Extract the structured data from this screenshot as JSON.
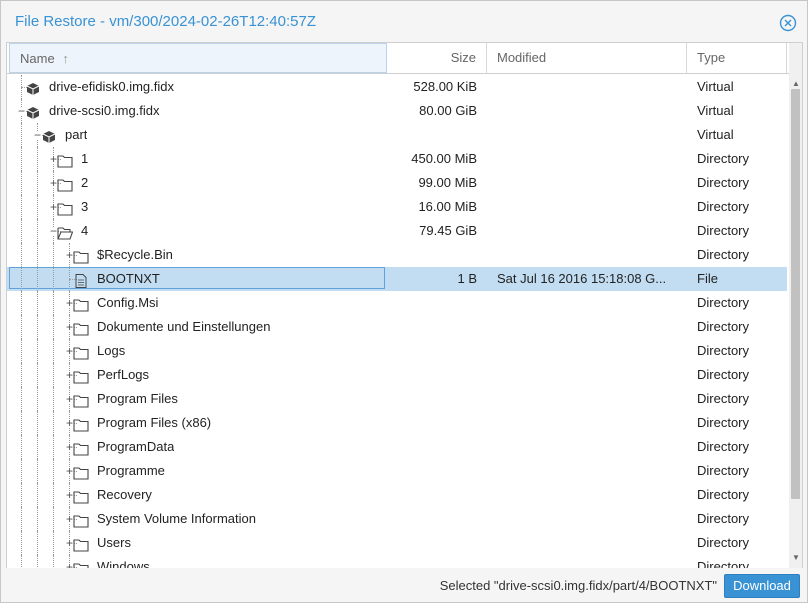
{
  "window": {
    "title": "File Restore - vm/300/2024-02-26T12:40:57Z",
    "accent_color": "#3892d4",
    "close_icon": "close-circle-icon"
  },
  "columns": {
    "name": "Name",
    "size": "Size",
    "modified": "Modified",
    "type": "Type",
    "sort_icon": "sort-ascending-arrow-icon"
  },
  "rows": [
    {
      "name": "drive-efidisk0.img.fidx",
      "size": "528.00 KiB",
      "modified": "",
      "type": "Virtual",
      "icon": "cube-icon",
      "depth": 0,
      "expander": "none",
      "selected": false
    },
    {
      "name": "drive-scsi0.img.fidx",
      "size": "80.00 GiB",
      "modified": "",
      "type": "Virtual",
      "icon": "cube-icon",
      "depth": 0,
      "expander": "minus",
      "selected": false
    },
    {
      "name": "part",
      "size": "",
      "modified": "",
      "type": "Virtual",
      "icon": "cube-icon",
      "depth": 1,
      "expander": "minus",
      "selected": false
    },
    {
      "name": "1",
      "size": "450.00 MiB",
      "modified": "",
      "type": "Directory",
      "icon": "folder-icon",
      "depth": 2,
      "expander": "plus",
      "selected": false
    },
    {
      "name": "2",
      "size": "99.00 MiB",
      "modified": "",
      "type": "Directory",
      "icon": "folder-icon",
      "depth": 2,
      "expander": "plus",
      "selected": false
    },
    {
      "name": "3",
      "size": "16.00 MiB",
      "modified": "",
      "type": "Directory",
      "icon": "folder-icon",
      "depth": 2,
      "expander": "plus",
      "selected": false
    },
    {
      "name": "4",
      "size": "79.45 GiB",
      "modified": "",
      "type": "Directory",
      "icon": "folder-open-icon",
      "depth": 2,
      "expander": "minus",
      "selected": false
    },
    {
      "name": "$Recycle.Bin",
      "size": "",
      "modified": "",
      "type": "Directory",
      "icon": "folder-icon",
      "depth": 3,
      "expander": "plus",
      "selected": false
    },
    {
      "name": "BOOTNXT",
      "size": "1 B",
      "modified": "Sat Jul 16 2016 15:18:08 G...",
      "type": "File",
      "icon": "file-icon",
      "depth": 3,
      "expander": "none",
      "selected": true
    },
    {
      "name": "Config.Msi",
      "size": "",
      "modified": "",
      "type": "Directory",
      "icon": "folder-icon",
      "depth": 3,
      "expander": "plus",
      "selected": false
    },
    {
      "name": "Dokumente und Einstellungen",
      "size": "",
      "modified": "",
      "type": "Directory",
      "icon": "folder-icon",
      "depth": 3,
      "expander": "plus",
      "selected": false
    },
    {
      "name": "Logs",
      "size": "",
      "modified": "",
      "type": "Directory",
      "icon": "folder-icon",
      "depth": 3,
      "expander": "plus",
      "selected": false
    },
    {
      "name": "PerfLogs",
      "size": "",
      "modified": "",
      "type": "Directory",
      "icon": "folder-icon",
      "depth": 3,
      "expander": "plus",
      "selected": false
    },
    {
      "name": "Program Files",
      "size": "",
      "modified": "",
      "type": "Directory",
      "icon": "folder-icon",
      "depth": 3,
      "expander": "plus",
      "selected": false
    },
    {
      "name": "Program Files (x86)",
      "size": "",
      "modified": "",
      "type": "Directory",
      "icon": "folder-icon",
      "depth": 3,
      "expander": "plus",
      "selected": false
    },
    {
      "name": "ProgramData",
      "size": "",
      "modified": "",
      "type": "Directory",
      "icon": "folder-icon",
      "depth": 3,
      "expander": "plus",
      "selected": false
    },
    {
      "name": "Programme",
      "size": "",
      "modified": "",
      "type": "Directory",
      "icon": "folder-icon",
      "depth": 3,
      "expander": "plus",
      "selected": false
    },
    {
      "name": "Recovery",
      "size": "",
      "modified": "",
      "type": "Directory",
      "icon": "folder-icon",
      "depth": 3,
      "expander": "plus",
      "selected": false
    },
    {
      "name": "System Volume Information",
      "size": "",
      "modified": "",
      "type": "Directory",
      "icon": "folder-icon",
      "depth": 3,
      "expander": "plus",
      "selected": false
    },
    {
      "name": "Users",
      "size": "",
      "modified": "",
      "type": "Directory",
      "icon": "folder-icon",
      "depth": 3,
      "expander": "plus",
      "selected": false
    },
    {
      "name": "Windows",
      "size": "",
      "modified": "",
      "type": "Directory",
      "icon": "folder-icon",
      "depth": 3,
      "expander": "plus",
      "selected": false
    }
  ],
  "footer": {
    "status": "Selected \"drive-scsi0.img.fidx/part/4/BOOTNXT\"",
    "download_label": "Download"
  }
}
